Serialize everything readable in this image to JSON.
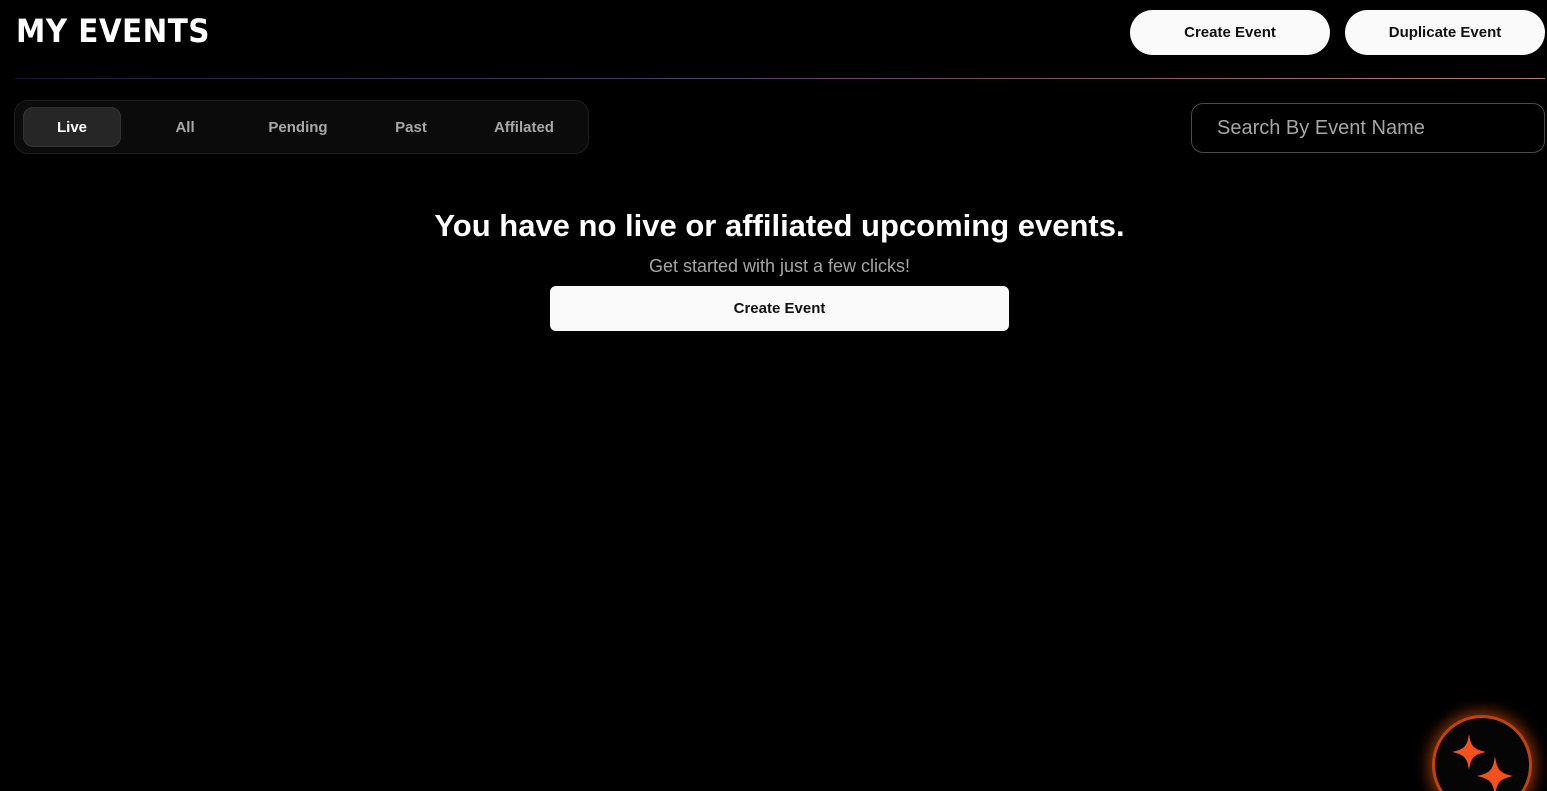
{
  "header": {
    "title": "MY EVENTS",
    "create_label": "Create Event",
    "duplicate_label": "Duplicate Event"
  },
  "tabs": [
    {
      "label": "Live",
      "active": true
    },
    {
      "label": "All",
      "active": false
    },
    {
      "label": "Pending",
      "active": false
    },
    {
      "label": "Past",
      "active": false
    },
    {
      "label": "Affilated",
      "active": false
    }
  ],
  "search": {
    "placeholder": "Search By Event Name",
    "value": ""
  },
  "empty_state": {
    "heading": "You have no live or affiliated upcoming events.",
    "subtext": "Get started with just a few clicks!",
    "cta_label": "Create Event"
  },
  "assistant": {
    "icon": "sparkles-icon",
    "accent_color": "#ea580c"
  }
}
